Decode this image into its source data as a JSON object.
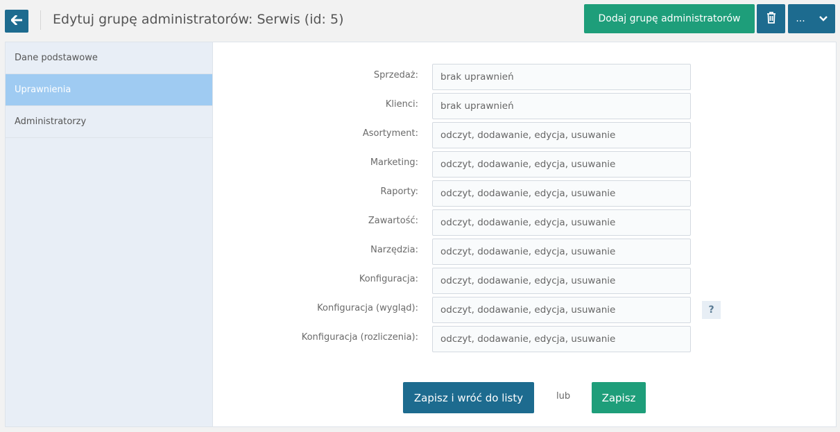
{
  "header": {
    "title": "Edytuj grupę administratorów: Serwis (id: 5)",
    "add_group_label": "Dodaj grupę administratorów",
    "more_label": "...",
    "back_icon": "arrow-left-icon",
    "trash_icon": "trash-icon",
    "chevron_icon": "chevron-down-icon"
  },
  "sidebar": {
    "items": [
      {
        "label": "Dane podstawowe",
        "active": false
      },
      {
        "label": "Uprawnienia",
        "active": true
      },
      {
        "label": "Administratorzy",
        "active": false
      }
    ]
  },
  "permissions": [
    {
      "label": "Sprzedaż:",
      "value": "brak uprawnień"
    },
    {
      "label": "Klienci:",
      "value": "brak uprawnień"
    },
    {
      "label": "Asortyment:",
      "value": "odczyt, dodawanie, edycja, usuwanie"
    },
    {
      "label": "Marketing:",
      "value": "odczyt, dodawanie, edycja, usuwanie"
    },
    {
      "label": "Raporty:",
      "value": "odczyt, dodawanie, edycja, usuwanie"
    },
    {
      "label": "Zawartość:",
      "value": "odczyt, dodawanie, edycja, usuwanie"
    },
    {
      "label": "Narzędzia:",
      "value": "odczyt, dodawanie, edycja, usuwanie"
    },
    {
      "label": "Konfiguracja:",
      "value": "odczyt, dodawanie, edycja, usuwanie"
    },
    {
      "label": "Konfiguracja (wygląd):",
      "value": "odczyt, dodawanie, edycja, usuwanie",
      "help": "?"
    },
    {
      "label": "Konfiguracja (rozliczenia):",
      "value": "odczyt, dodawanie, edycja, usuwanie"
    }
  ],
  "actions": {
    "save_back_label": "Zapisz i wróć do listy",
    "or_label": "lub",
    "save_label": "Zapisz"
  },
  "colors": {
    "primary": "#1d6b8f",
    "success": "#1e9e7a",
    "sidebar_active": "#9fcbf2",
    "sidebar_bg": "#e8eef6"
  }
}
